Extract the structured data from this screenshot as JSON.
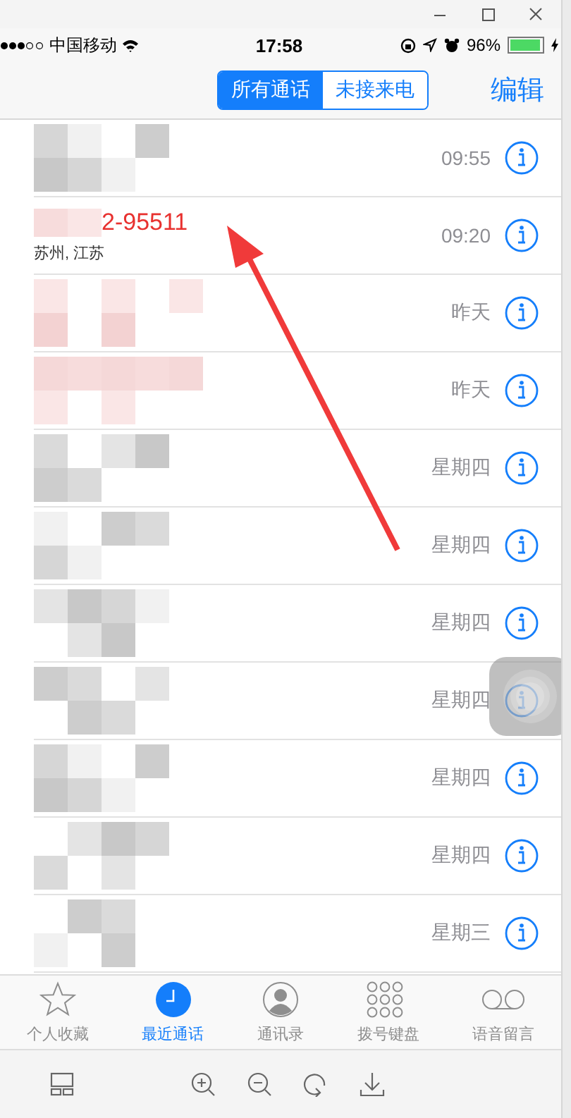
{
  "window": {
    "controls": [
      {
        "kind": "minimize"
      },
      {
        "kind": "maximize"
      },
      {
        "kind": "close"
      }
    ]
  },
  "status_bar": {
    "carrier": "中国移动",
    "time": "17:58",
    "battery": "96%"
  },
  "nav": {
    "segments": [
      {
        "label": "所有通话",
        "selected": true
      },
      {
        "label": "未接来电",
        "selected": false
      }
    ],
    "edit": "编辑"
  },
  "calls": [
    {
      "kind": "blurred",
      "missed": false,
      "time": "09:55"
    },
    {
      "kind": "named",
      "missed": true,
      "name": "2-95511",
      "location": "苏州, 江苏",
      "time": "09:20"
    },
    {
      "kind": "blurred",
      "missed": true,
      "time": "昨天"
    },
    {
      "kind": "blurred",
      "missed": true,
      "time": "昨天"
    },
    {
      "kind": "blurred",
      "missed": false,
      "time": "星期四"
    },
    {
      "kind": "blurred",
      "missed": false,
      "time": "星期四"
    },
    {
      "kind": "blurred",
      "missed": false,
      "time": "星期四"
    },
    {
      "kind": "blurred",
      "missed": false,
      "time": "星期四"
    },
    {
      "kind": "blurred",
      "missed": false,
      "time": "星期四"
    },
    {
      "kind": "blurred",
      "missed": false,
      "time": "星期四"
    },
    {
      "kind": "blurred",
      "missed": false,
      "time": "星期三"
    }
  ],
  "tabs": [
    {
      "kind": "favorites",
      "label": "个人收藏",
      "selected": false
    },
    {
      "kind": "recents",
      "label": "最近通话",
      "selected": true
    },
    {
      "kind": "contacts",
      "label": "通讯录",
      "selected": false
    },
    {
      "kind": "keypad",
      "label": "拨号键盘",
      "selected": false
    },
    {
      "kind": "voicemail",
      "label": "语音留言",
      "selected": false
    }
  ],
  "toolbar": [
    {
      "kind": "layout"
    },
    {
      "kind": "zoom_in"
    },
    {
      "kind": "zoom_out"
    },
    {
      "kind": "rotate"
    },
    {
      "kind": "download"
    }
  ]
}
